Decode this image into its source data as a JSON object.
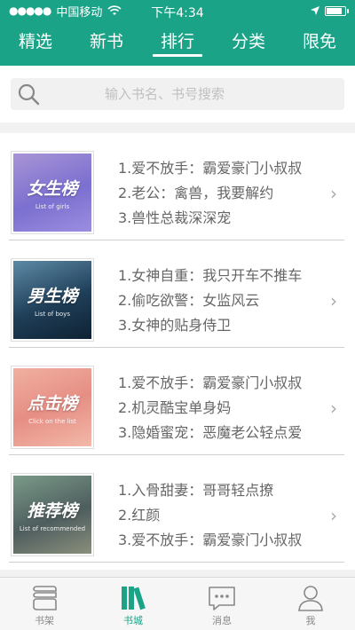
{
  "status": {
    "carrier": "中国移动",
    "time": "下午4:34"
  },
  "tabs": [
    {
      "label": "精选"
    },
    {
      "label": "新书"
    },
    {
      "label": "排行"
    },
    {
      "label": "分类"
    },
    {
      "label": "限免"
    }
  ],
  "active_tab": "排行",
  "search": {
    "placeholder": "输入书名、书号搜索"
  },
  "rankings": [
    {
      "cover_title": "女生榜",
      "cover_sub": "List of girls",
      "lines": [
        "1.爱不放手：霸爱豪门小叔叔",
        "2.老公：禽兽，我要解约",
        "3.兽性总裁深深宠"
      ]
    },
    {
      "cover_title": "男生榜",
      "cover_sub": "List of boys",
      "lines": [
        "1.女神自重：我只开车不推车",
        "2.偷吃欲警：女监风云",
        "3.女神的贴身侍卫"
      ]
    },
    {
      "cover_title": "点击榜",
      "cover_sub": "Click on the list",
      "lines": [
        "1.爱不放手：霸爱豪门小叔叔",
        "2.机灵酷宝单身妈",
        "3.隐婚蜜宠：恶魔老公轻点爱"
      ]
    },
    {
      "cover_title": "推荐榜",
      "cover_sub": "List of recommended",
      "lines": [
        "1.入骨甜妻：哥哥轻点撩",
        "2.红颜",
        "3.爱不放手：霸爱豪门小叔叔"
      ]
    }
  ],
  "tabbar": [
    {
      "label": "书架",
      "icon": "bookshelf-icon"
    },
    {
      "label": "书城",
      "icon": "bookstore-icon"
    },
    {
      "label": "消息",
      "icon": "message-icon"
    },
    {
      "label": "我",
      "icon": "profile-icon"
    }
  ],
  "active_tabbar": "书城",
  "colors": {
    "brand": "#1aa387"
  }
}
